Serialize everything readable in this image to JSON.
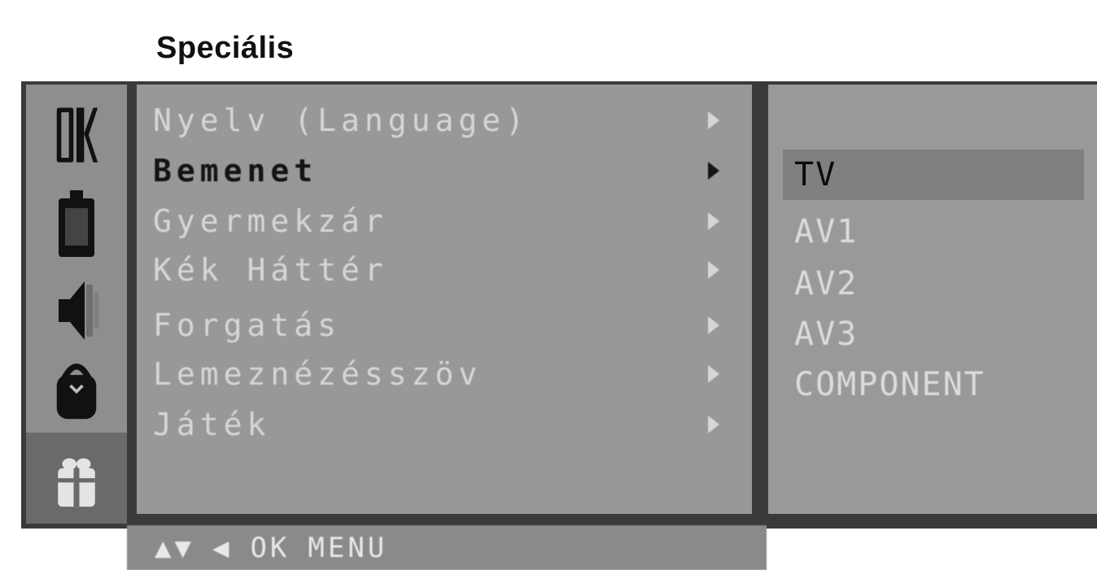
{
  "page": {
    "title": "Speciális"
  },
  "sidebar": {
    "icons": [
      {
        "name": "ok-text-icon",
        "glyph": "OK"
      },
      {
        "name": "disc-icon"
      },
      {
        "name": "speaker-icon"
      },
      {
        "name": "lock-icon"
      },
      {
        "name": "gift-icon",
        "selected": true
      }
    ]
  },
  "menu": {
    "items": [
      {
        "label": "Nyelv (Language)",
        "arrow": "right-arrow-icon"
      },
      {
        "label": "Bemenet",
        "arrow": "right-arrow-icon",
        "active": true
      },
      {
        "label": "Gyermekzár",
        "arrow": "right-arrow-icon"
      },
      {
        "label": "Kék Háttér",
        "arrow": "right-arrow-icon"
      },
      {
        "label": "Forgatás",
        "arrow": "right-arrow-icon"
      },
      {
        "label": "Lemeznézésszöv",
        "arrow": "right-arrow-icon"
      },
      {
        "label": "Játék",
        "arrow": "right-arrow-icon"
      }
    ]
  },
  "submenu": {
    "items": [
      {
        "label": "TV",
        "active": true
      },
      {
        "label": "AV1"
      },
      {
        "label": "AV2"
      },
      {
        "label": "AV3"
      },
      {
        "label": "COMPONENT"
      }
    ]
  },
  "hints": {
    "nav": "▲▼",
    "back": "◀",
    "ok": "OK",
    "menu": "MENU"
  },
  "colors": {
    "menu_bg": "#989898",
    "active_text": "#141414",
    "inactive_text": "#d6d6d6"
  }
}
